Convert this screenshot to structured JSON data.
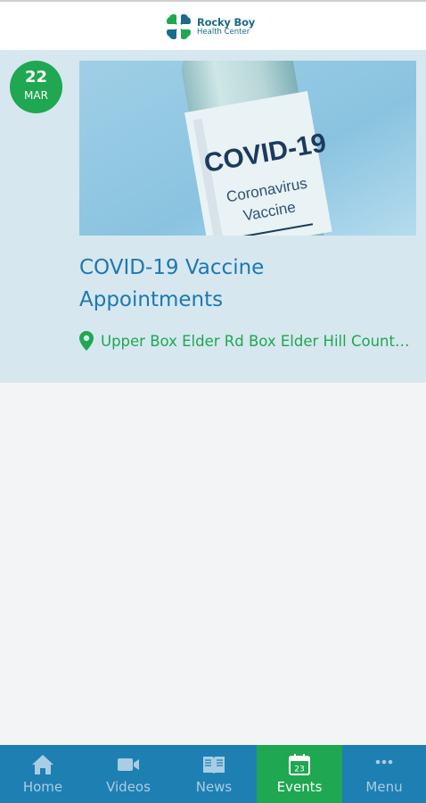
{
  "header": {
    "logo_line1": "Rocky Boy",
    "logo_line2": "Health Center"
  },
  "event": {
    "day": "22",
    "month": "MAR",
    "image_text_title": "COVID-19",
    "image_text_line1": "Coronavirus",
    "image_text_line2": "Vaccine",
    "title": "COVID-19 Vaccine Appointments",
    "location": "Upper Box Elder Rd Box Elder Hill County Montana"
  },
  "tabs": [
    {
      "label": "Home",
      "icon": "home-icon"
    },
    {
      "label": "Videos",
      "icon": "video-camera-icon"
    },
    {
      "label": "News",
      "icon": "book-icon"
    },
    {
      "label": "Events",
      "icon": "calendar-icon",
      "active": true
    },
    {
      "label": "Menu",
      "icon": "more-dots-icon"
    }
  ],
  "colors": {
    "primary_blue": "#1e7fb3",
    "accent_green": "#1fa751",
    "card_background": "#d6e7ef",
    "title_blue": "#1e78b0"
  }
}
